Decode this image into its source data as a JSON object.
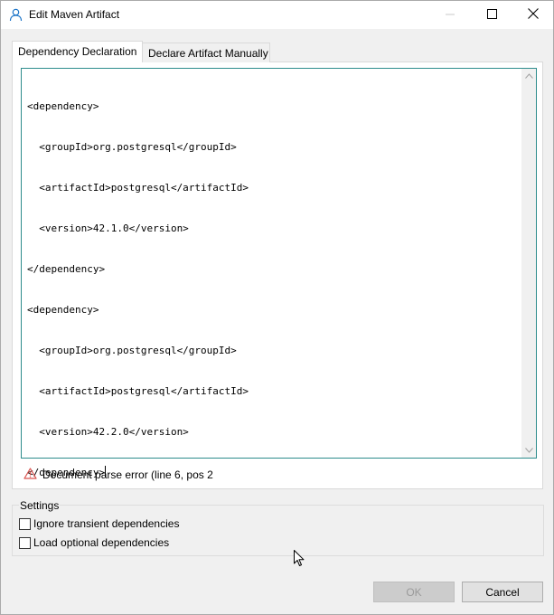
{
  "window": {
    "title": "Edit Maven Artifact",
    "icon": "person-icon"
  },
  "tabs": [
    {
      "label": "Dependency Declaration",
      "active": true
    },
    {
      "label": "Declare Artifact Manually",
      "active": false
    }
  ],
  "editor": {
    "lines": [
      "<dependency>",
      "  <groupId>org.postgresql</groupId>",
      "  <artifactId>postgresql</artifactId>",
      "  <version>42.1.0</version>",
      "</dependency>",
      "<dependency>",
      "  <groupId>org.postgresql</groupId>",
      "  <artifactId>postgresql</artifactId>",
      "  <version>42.2.0</version>",
      "</dependency>"
    ]
  },
  "error": {
    "icon": "warning-icon",
    "message": "Document parse error (line 6, pos 2"
  },
  "settings": {
    "label": "Settings",
    "ignore_transient": {
      "label": "Ignore transient dependencies",
      "checked": false
    },
    "load_optional": {
      "label": "Load optional dependencies",
      "checked": false
    }
  },
  "buttons": {
    "ok_label": "OK",
    "ok_enabled": false,
    "cancel_label": "Cancel"
  },
  "colors": {
    "editor_border": "#2d8c8c",
    "warning": "#d9534f"
  }
}
